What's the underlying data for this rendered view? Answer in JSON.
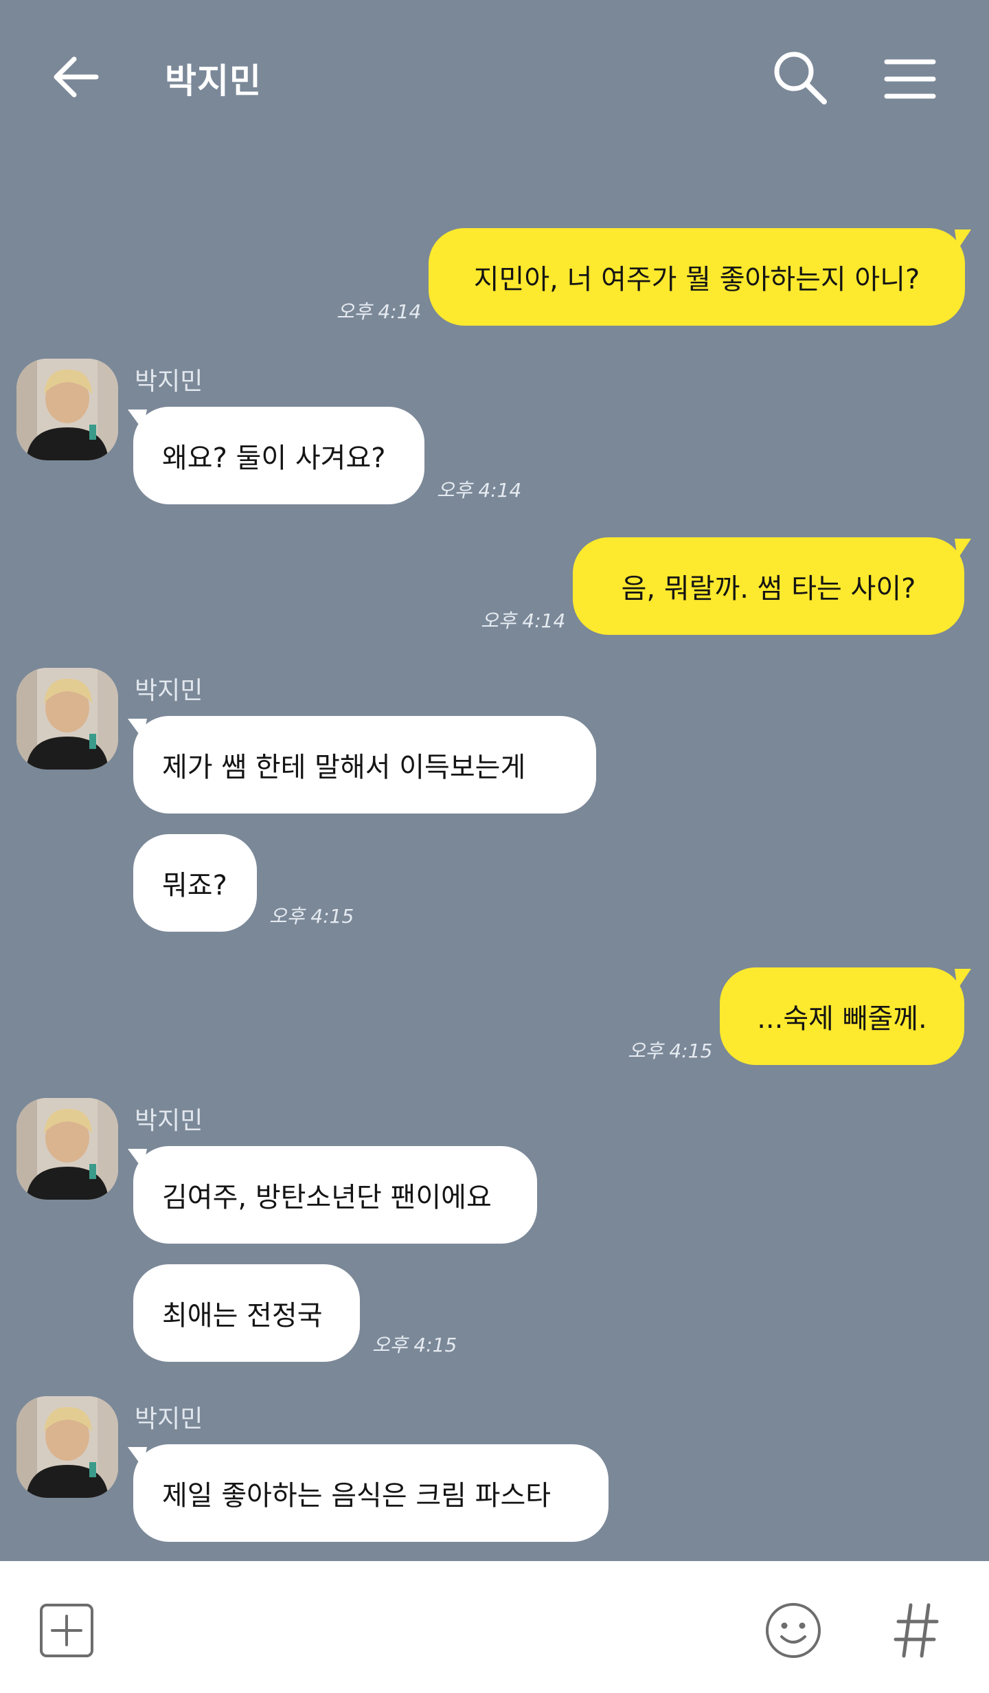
{
  "header": {
    "title": "박지민"
  },
  "messages": [
    {
      "from": "me",
      "text": "지민아, 너 여주가 뭘 좋아하는지 아니?",
      "time": "오후 4:14"
    },
    {
      "from": "other",
      "sender": "박지민",
      "text": "왜요? 둘이 사겨요?",
      "time": "오후 4:14"
    },
    {
      "from": "me",
      "text": "음, 뭐랄까. 썸 타는 사이?",
      "time": "오후 4:14"
    },
    {
      "from": "other",
      "sender": "박지민",
      "text": "제가 쌤 한테 말해서 이득보는게"
    },
    {
      "from": "other",
      "text": "뭐죠?",
      "time": "오후 4:15"
    },
    {
      "from": "me",
      "text": "...숙제 빼줄께.",
      "time": "오후 4:15"
    },
    {
      "from": "other",
      "sender": "박지민",
      "text": "김여주, 방탄소년단 팬이에요"
    },
    {
      "from": "other",
      "text": "최애는 전정국",
      "time": "오후 4:15"
    },
    {
      "from": "other",
      "sender": "박지민",
      "text": "제일 좋아하는 음식은 크림 파스타"
    }
  ],
  "colors": {
    "background": "#7b8898",
    "my_bubble": "#fde92d",
    "other_bubble": "#ffffff",
    "input_bar": "#ffffff"
  },
  "icons": {
    "back": "arrow-left-icon",
    "search": "search-icon",
    "menu": "hamburger-menu-icon",
    "attach": "plus-square-icon",
    "emoji": "smiley-icon",
    "hashtag": "hash-icon"
  }
}
